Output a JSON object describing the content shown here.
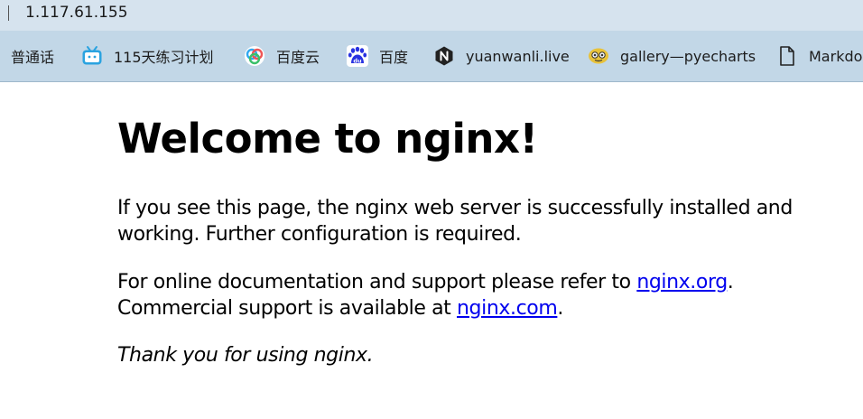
{
  "browser": {
    "address": "1.117.61.155",
    "bookmarks": [
      {
        "label": "普通话",
        "icon": "none"
      },
      {
        "label": "115天练习计划",
        "icon": "bilibili-tv-icon",
        "color": "#00a1d6"
      },
      {
        "label": "百度云",
        "icon": "baidu-cloud-icon"
      },
      {
        "label": "百度",
        "icon": "baidu-paw-icon",
        "color": "#2932e1"
      },
      {
        "label": "yuanwanli.live",
        "icon": "nginx-n-icon",
        "color": "#222222"
      },
      {
        "label": "gallery—pyecharts",
        "icon": "pyecharts-logo-icon",
        "color": "#e8c23a"
      },
      {
        "label": "Markdo",
        "icon": "document-icon"
      }
    ]
  },
  "page": {
    "heading": "Welcome to nginx!",
    "p1": "If you see this page, the nginx web server is successfully installed and working. Further configuration is required.",
    "p2_a": "For online documentation and support please refer to ",
    "link1": "nginx.org",
    "p2_b": ".",
    "p2_c": "Commercial support is available at ",
    "link2": "nginx.com",
    "p2_d": ".",
    "p3": "Thank you for using nginx.",
    "link_color": "#0000ee"
  }
}
